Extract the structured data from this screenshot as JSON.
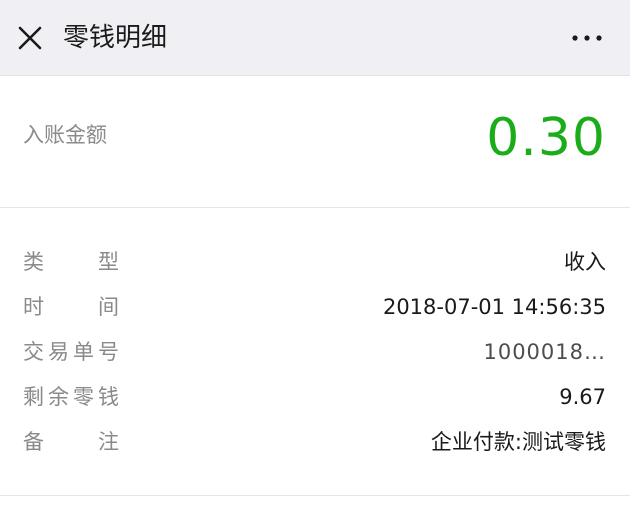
{
  "nav": {
    "title": "零钱明细"
  },
  "amount": {
    "label": "入账金额",
    "value": "0.30",
    "color": "#1aad19"
  },
  "details": [
    {
      "label": "类型",
      "value": "收入"
    },
    {
      "label": "时间",
      "value": "2018-07-01 14:56:35"
    },
    {
      "label": "交易单号",
      "value": "1000018…"
    },
    {
      "label": "剩余零钱",
      "value": "9.67"
    },
    {
      "label": "备注",
      "value": "企业付款:测试零钱"
    }
  ]
}
